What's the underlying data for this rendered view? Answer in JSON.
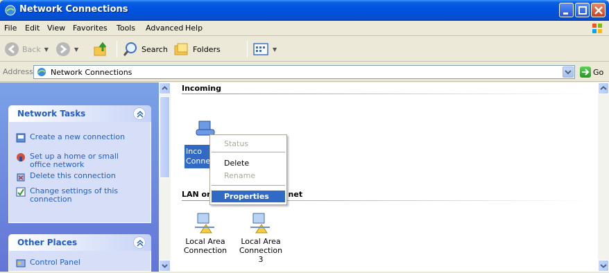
{
  "window": {
    "title": "Network Connections"
  },
  "menu": [
    "File",
    "Edit",
    "View",
    "Favorites",
    "Tools",
    "Advanced",
    "Help"
  ],
  "toolbar": {
    "back": "Back",
    "search": "Search",
    "folders": "Folders"
  },
  "address": {
    "label": "Address",
    "value": "Network Connections",
    "go": "Go"
  },
  "taskpane": {
    "network_tasks_title": "Network Tasks",
    "tasks": [
      {
        "label": "Create a new connection",
        "icon": "new-connection-icon"
      },
      {
        "label": "Set up a home or small office network",
        "icon": "home-network-icon"
      },
      {
        "label": "Delete this connection",
        "icon": "delete-connection-icon"
      },
      {
        "label": "Change settings of this connection",
        "icon": "settings-icon"
      }
    ],
    "other_places_title": "Other Places",
    "other_places": [
      {
        "label": "Control Panel",
        "icon": "control-panel-icon"
      }
    ]
  },
  "content": {
    "groups": [
      {
        "title": "Incoming",
        "items": [
          {
            "label": "Incoming Connections",
            "visible_label": "Inco\nConne"
          }
        ]
      },
      {
        "title": "LAN or High-Speed Internet",
        "title_left": "LAN or",
        "title_right": "net",
        "items": [
          {
            "label": "Local Area Connection"
          },
          {
            "label": "Local Area Connection 3"
          }
        ]
      }
    ]
  },
  "context_menu": {
    "items": [
      {
        "label": "Status",
        "state": "disabled"
      },
      {
        "label": "Delete",
        "state": "enabled"
      },
      {
        "label": "Rename",
        "state": "disabled"
      },
      {
        "label": "Properties",
        "state": "selected"
      }
    ]
  },
  "colors": {
    "titlebar": "#0054e3",
    "taskpane": "#6375d6",
    "selection": "#316ac5",
    "task_link": "#215dc6"
  }
}
